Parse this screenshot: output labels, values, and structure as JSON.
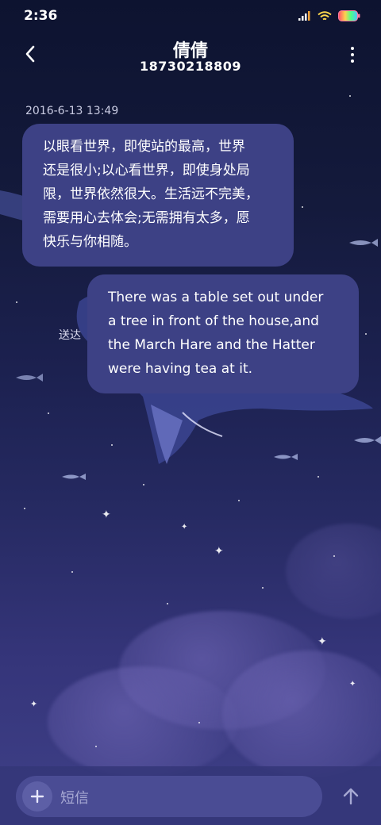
{
  "status_bar": {
    "time": "2:36",
    "icons": [
      "signal-icon",
      "wifi-icon",
      "battery-icon"
    ]
  },
  "header": {
    "title": "倩倩",
    "subtitle": "18730218809",
    "back_icon": "chevron-left-icon",
    "more_icon": "more-vertical-icon"
  },
  "conversation": {
    "timestamp": "2016-6-13 13:49",
    "messages": [
      {
        "direction": "incoming",
        "lines": [
          "以眼看世界，即使站的最高，世界",
          "还是很小;以心看世界，即使身处局",
          "限，世界依然很大。生活远不完美，",
          "需要用心去体会;无需拥有太多，愿",
          "快乐与你相随。"
        ]
      },
      {
        "direction": "outgoing",
        "status": "送达",
        "lines": [
          "There was a table set out under",
          "a tree in front of the house,and",
          "the March Hare and the Hatter",
          "were having tea at it."
        ]
      }
    ]
  },
  "input_bar": {
    "add_icon": "plus-icon",
    "placeholder": "短信",
    "send_icon": "arrow-up-icon"
  },
  "colors": {
    "bubble": "#3d4185",
    "background_top": "#0d1330",
    "background_bottom": "#3f4088",
    "battery_gradient": [
      "#ff4d4d",
      "#ffd24d",
      "#4dff88",
      "#4dc3ff"
    ]
  }
}
